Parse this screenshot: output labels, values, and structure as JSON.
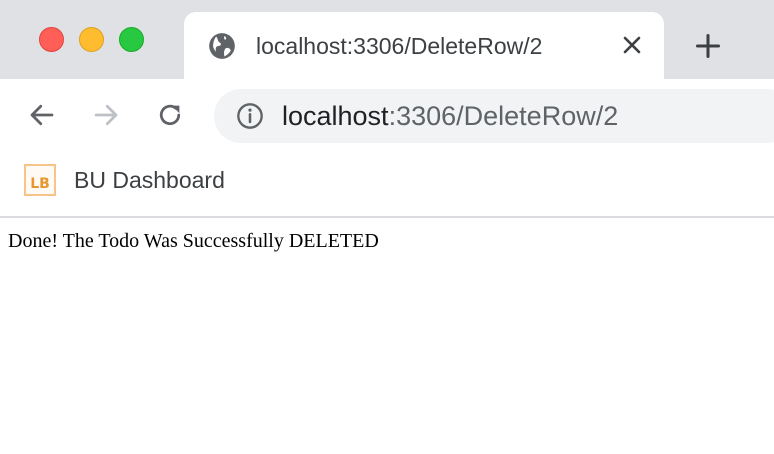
{
  "window": {
    "controls": [
      "close",
      "minimize",
      "zoom"
    ]
  },
  "tab": {
    "title": "localhost:3306/DeleteRow/2",
    "icon": "globe-icon"
  },
  "toolbar": {
    "url_host": "localhost",
    "url_path": ":3306/DeleteRow/2"
  },
  "bookmarks": [
    {
      "label": "BU Dashboard",
      "icon_text": "LB"
    }
  ],
  "page": {
    "message": "Done! The Todo Was Successfully DELETED"
  },
  "colors": {
    "tabstrip": "#dfe1e5",
    "omnibox": "#f1f3f4",
    "close": "#ff5f57",
    "minimize": "#febc2e",
    "zoom": "#28c840"
  }
}
